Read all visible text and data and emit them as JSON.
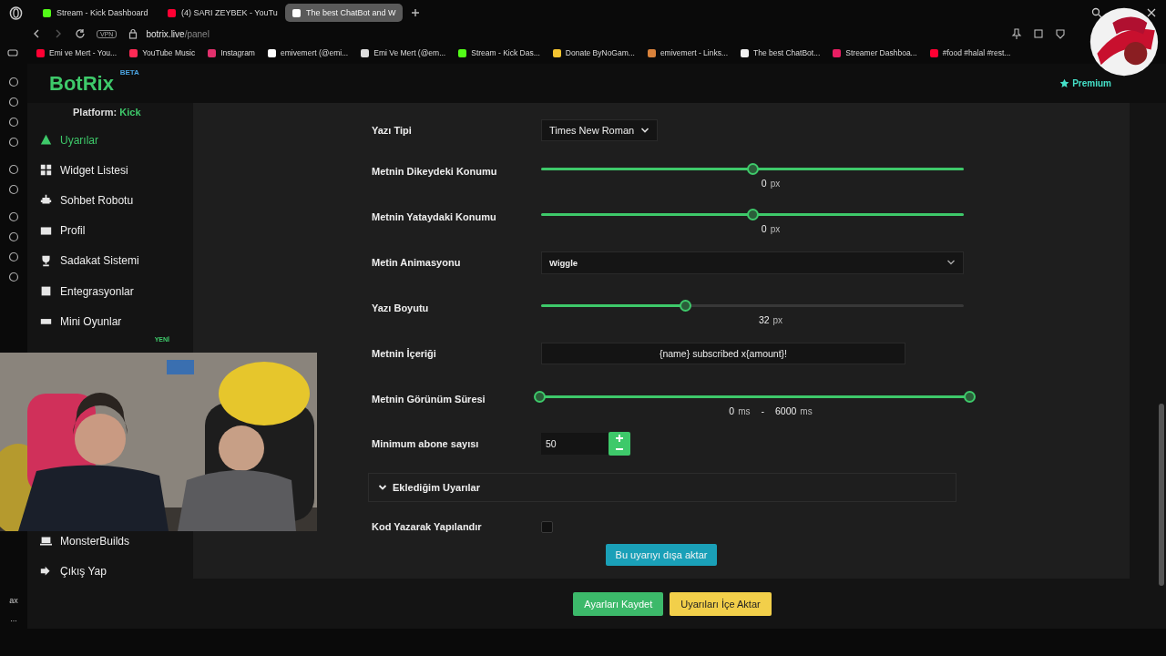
{
  "browser": {
    "tabs": [
      {
        "title": "Stream - Kick Dashboard",
        "selected": false,
        "color": "#53fc18"
      },
      {
        "title": "(4) SARI ZEYBEK - YouTu",
        "selected": false,
        "color": "#ff0033"
      },
      {
        "title": "The best ChatBot and W",
        "selected": true,
        "color": "#ffffff"
      }
    ],
    "vpn_badge": "VPN",
    "address": {
      "host": "botrix.live",
      "path": "/panel"
    },
    "bookmarks": [
      {
        "label": "Emi ve Mert - You...",
        "color": "#ff0033"
      },
      {
        "label": "YouTube Music",
        "color": "#ff2a55"
      },
      {
        "label": "Instagram",
        "color": "#e1306c"
      },
      {
        "label": "emivemert (@emi...",
        "color": "#ffffff"
      },
      {
        "label": "Emi Ve Mert (@em...",
        "color": "#dddddd"
      },
      {
        "label": "Stream - Kick Das...",
        "color": "#53fc18"
      },
      {
        "label": "Donate ByNoGam...",
        "color": "#f4c430"
      },
      {
        "label": "emivemert - Links...",
        "color": "#d9823b"
      },
      {
        "label": "The best ChatBot...",
        "color": "#f0f0f0"
      },
      {
        "label": "Streamer Dashboa...",
        "color": "#e91e63"
      },
      {
        "label": "#food #halal #rest...",
        "color": "#ff0033"
      }
    ],
    "rail_footer": [
      "ax",
      "..."
    ]
  },
  "header": {
    "logo": "BotRix",
    "badge": "BETA",
    "premium": "Premium"
  },
  "sidebar": {
    "platform_label": "Platform:",
    "platform": "Kick",
    "items": [
      {
        "label": "Uyarılar",
        "selected": true
      },
      {
        "label": "Widget Listesi",
        "selected": false
      },
      {
        "label": "Sohbet Robotu",
        "selected": false
      },
      {
        "label": "Profil",
        "selected": false
      },
      {
        "label": "Sadakat Sistemi",
        "selected": false
      },
      {
        "label": "Entegrasyonlar",
        "selected": false
      },
      {
        "label": "Mini Oyunlar",
        "selected": false
      }
    ],
    "new_badge": "YENİ",
    "bottom_items": [
      {
        "label": "MonsterBuilds",
        "selected": false
      },
      {
        "label": "Çıkış Yap",
        "selected": false
      }
    ]
  },
  "form": {
    "rows": [
      {
        "kind": "font-select",
        "label": "Yazı Tipi",
        "value": "Times New Roman"
      },
      {
        "kind": "offset-slider",
        "label": "Metnin Dikeydeki Konumu",
        "level": 0.5,
        "value": "0",
        "unit": "px"
      },
      {
        "kind": "offset-slider",
        "label": "Metnin Yataydaki Konumu",
        "level": 0.5,
        "value": "0",
        "unit": "px"
      },
      {
        "kind": "select",
        "label": "Metin Animasyonu",
        "value": "Wiggle"
      },
      {
        "kind": "slider",
        "label": "Yazı Boyutu",
        "level": 0.34,
        "value": "32",
        "unit": "px"
      },
      {
        "kind": "text",
        "label": "Metnin İçeriği",
        "value": "{name} subscribed x{amount}!"
      },
      {
        "kind": "range",
        "label": "Metnin Görünüm Süresi",
        "thumbs": [
          {
            "level": 0,
            "value": "0",
            "unit": "ms"
          },
          {
            "level": 1,
            "value": "6000",
            "unit": "ms"
          }
        ],
        "separator": "-"
      },
      {
        "kind": "number",
        "label": "Minimum abone sayısı",
        "value": "50"
      }
    ],
    "section": {
      "title": "Eklediğim Uyarılar",
      "expanded": false
    },
    "code_toggle": {
      "label": "Kod Yazarak Yapılandır",
      "checked": false
    },
    "export_button": "Bu uyarıyı dışa aktar"
  },
  "footer_buttons": [
    {
      "label": "Ayarları Kaydet",
      "kind": "save"
    },
    {
      "label": "Uyarıları İçe Aktar",
      "kind": "import"
    }
  ]
}
